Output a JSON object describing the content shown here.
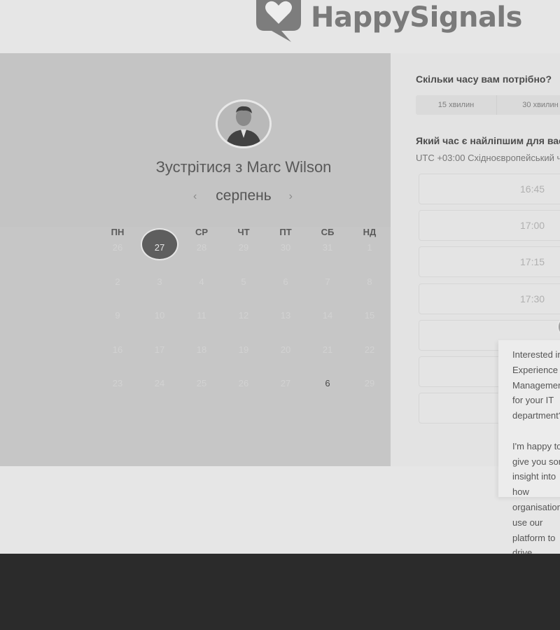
{
  "brand": {
    "name": "HappySignals",
    "accent": "#7a7a7a"
  },
  "host": {
    "title": "Зустрітися з Marc Wilson"
  },
  "calendar": {
    "month": "серпень",
    "prev_arrow": "‹",
    "next_arrow": "›",
    "weekdays": [
      "ПН",
      "ВТ",
      "СР",
      "ЧТ",
      "ПТ",
      "СБ",
      "НД"
    ],
    "weeks": [
      [
        "26",
        "27",
        "28",
        "29",
        "30",
        "31",
        "1"
      ],
      [
        "2",
        "3",
        "4",
        "5",
        "6",
        "7",
        "8"
      ],
      [
        "9",
        "10",
        "11",
        "12",
        "13",
        "14",
        "15"
      ],
      [
        "16",
        "17",
        "18",
        "19",
        "20",
        "21",
        "22"
      ],
      [
        "23",
        "24",
        "25",
        "26",
        "27",
        "28",
        "29"
      ]
    ],
    "selected_day": "27",
    "bold_day": "6"
  },
  "booking": {
    "duration_question": "Скільки часу вам потрібно?",
    "durations": [
      "15 хвилин",
      "30 хвилин"
    ],
    "time_question": "Який час є найліпшим для вас?",
    "timezone": "UTC +03:00 Східноєвропейський час",
    "slots": [
      "16:45",
      "17:00",
      "17:15",
      "17:30",
      "",
      "",
      ""
    ]
  },
  "chat": {
    "message": "Interested in Experience Management for your IT department?\n\nI'm happy to give you some insight into how organisations use our platform to drive improvements in employee productivity"
  }
}
